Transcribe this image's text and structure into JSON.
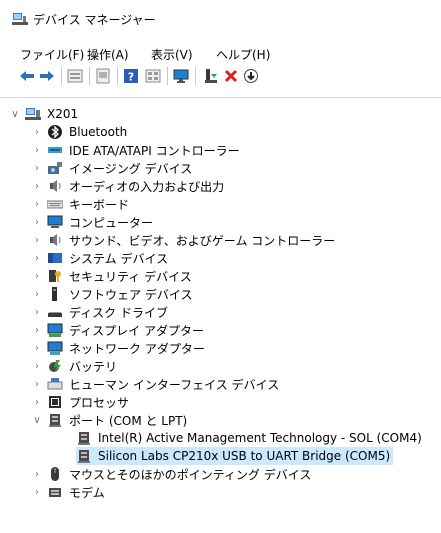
{
  "window": {
    "title": "デバイス マネージャー"
  },
  "menu": [
    "ファイル(F)",
    "操作(A)",
    "表示(V)",
    "ヘルプ(H)"
  ],
  "toolbar": {
    "buttons": [
      "back-arrow-icon",
      "forward-arrow-icon",
      "properties-icon",
      "update-driver-icon",
      "help-icon",
      "view-icon",
      "monitor-icon",
      "enable-device-icon",
      "uninstall-icon",
      "download-icon"
    ]
  },
  "tree": {
    "root": "X201",
    "categories": [
      {
        "label": "Bluetooth",
        "icon": "bluetooth-icon",
        "expanded": false
      },
      {
        "label": "IDE ATA/ATAPI コントローラー",
        "icon": "ide-controller-icon",
        "expanded": false
      },
      {
        "label": "イメージング デバイス",
        "icon": "imaging-device-icon",
        "expanded": false
      },
      {
        "label": "オーディオの入力および出力",
        "icon": "audio-icon",
        "expanded": false
      },
      {
        "label": "キーボード",
        "icon": "keyboard-icon",
        "expanded": false
      },
      {
        "label": "コンピューター",
        "icon": "computer-icon",
        "expanded": false
      },
      {
        "label": "サウンド、ビデオ、およびゲーム コントローラー",
        "icon": "sound-controller-icon",
        "expanded": false
      },
      {
        "label": "システム デバイス",
        "icon": "system-device-icon",
        "expanded": false
      },
      {
        "label": "セキュリティ デバイス",
        "icon": "security-device-icon",
        "expanded": false
      },
      {
        "label": "ソフトウェア デバイス",
        "icon": "software-device-icon",
        "expanded": false
      },
      {
        "label": "ディスク ドライブ",
        "icon": "disk-drive-icon",
        "expanded": false
      },
      {
        "label": "ディスプレイ アダプター",
        "icon": "display-adapter-icon",
        "expanded": false
      },
      {
        "label": "ネットワーク アダプター",
        "icon": "network-adapter-icon",
        "expanded": false
      },
      {
        "label": "バッテリ",
        "icon": "battery-icon",
        "expanded": false
      },
      {
        "label": "ヒューマン インターフェイス デバイス",
        "icon": "hid-icon",
        "expanded": false
      },
      {
        "label": "プロセッサ",
        "icon": "processor-icon",
        "expanded": false
      },
      {
        "label": "ポート (COM と LPT)",
        "icon": "port-icon",
        "expanded": true,
        "children": [
          {
            "label": "Intel(R) Active Management Technology - SOL (COM4)",
            "selected": false
          },
          {
            "label": "Silicon Labs CP210x USB to UART Bridge (COM5)",
            "selected": true
          }
        ]
      },
      {
        "label": "マウスとそのほかのポインティング デバイス",
        "icon": "mouse-icon",
        "expanded": false
      },
      {
        "label": "モデム",
        "icon": "modem-icon",
        "expanded": false
      }
    ]
  }
}
